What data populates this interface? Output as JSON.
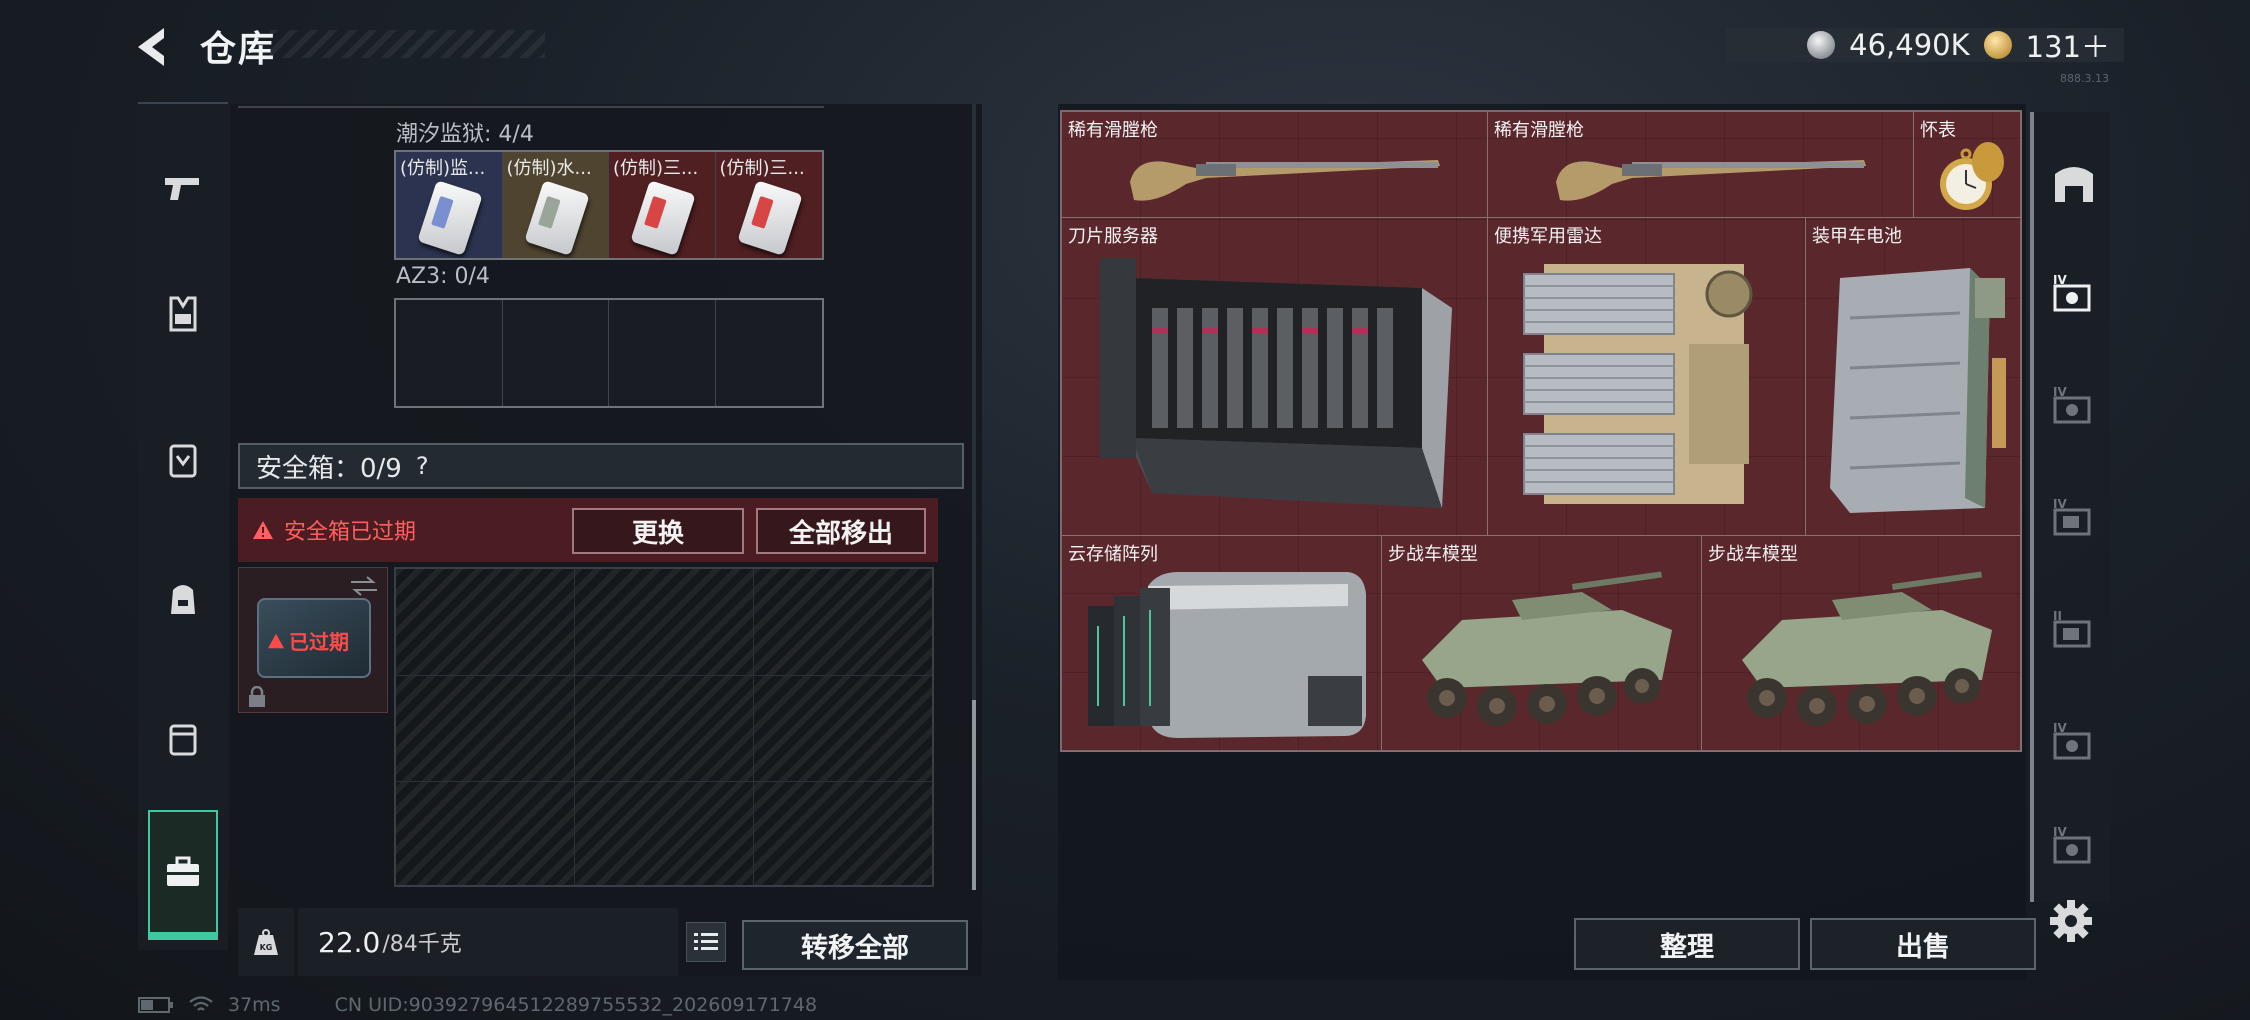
{
  "header": {
    "title": "仓库",
    "silver_amount": "46,490K",
    "gold_amount": "131＋",
    "version_text": "888.3.13"
  },
  "nav": {
    "items": [
      {
        "icon": "pistol-icon"
      },
      {
        "icon": "armor-vest-icon"
      },
      {
        "icon": "chest-rig-icon"
      },
      {
        "icon": "backpack-icon"
      },
      {
        "icon": "pouch-icon"
      },
      {
        "icon": "briefcase-icon",
        "active": true
      }
    ]
  },
  "inventory": {
    "section1_label": "潮汐监狱: 4/4",
    "section1_items": [
      {
        "label": "(仿制)监...",
        "rarity": "blue"
      },
      {
        "label": "(仿制)水...",
        "rarity": "gold"
      },
      {
        "label": "(仿制)三...",
        "rarity": "red"
      },
      {
        "label": "(仿制)三...",
        "rarity": "red"
      }
    ],
    "section2_label": "AZ3: 0/4",
    "safe_title": "安全箱：0/9",
    "safe_help": "?",
    "safe_expired_text": "安全箱已过期",
    "replace_btn": "更换",
    "move_all_out_btn": "全部移出",
    "safe_thumb_label": "已过期",
    "weight_value": "22.0",
    "weight_unit": "/84千克",
    "transfer_all_btn": "转移全部"
  },
  "status": {
    "ping": "37ms",
    "uid": "CN UID:903927964512289755532_202609171748"
  },
  "stash": {
    "items": [
      {
        "name": "稀有滑膛枪",
        "icon": "musket-icon"
      },
      {
        "name": "稀有滑膛枪",
        "icon": "musket-icon"
      },
      {
        "name": "怀表",
        "icon": "pocket-watch-icon"
      },
      {
        "name": "刀片服务器",
        "icon": "blade-server-icon"
      },
      {
        "name": "便携军用雷达",
        "icon": "military-radar-icon"
      },
      {
        "name": "装甲车电池",
        "icon": "vehicle-battery-icon"
      },
      {
        "name": "云存储阵列",
        "icon": "storage-array-icon"
      },
      {
        "name": "步战车模型",
        "icon": "ifv-model-icon"
      },
      {
        "name": "步战车模型",
        "icon": "ifv-model-icon"
      }
    ],
    "sort_btn": "整理",
    "sell_btn": "出售"
  },
  "colors": {
    "accent": "#3ec9a0",
    "expired": "#ff5f5f",
    "stash_bg": "#5a272c"
  }
}
